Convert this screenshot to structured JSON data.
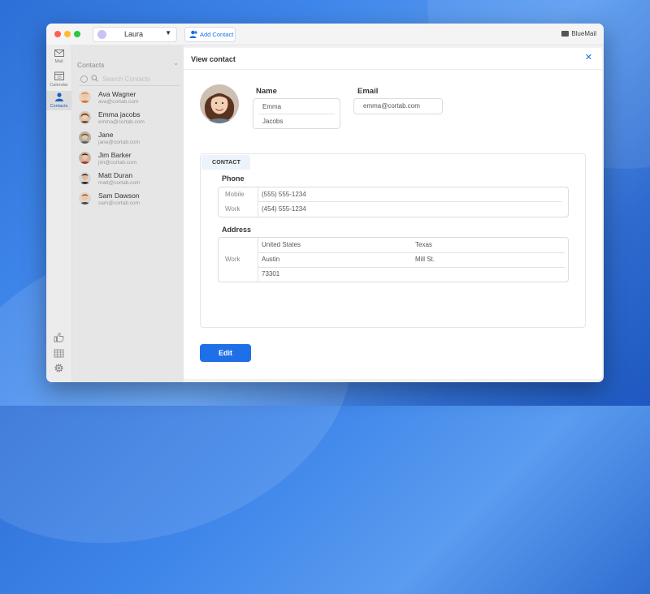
{
  "titlebar": {
    "account_name": "Laura",
    "add_contact_label": "Add Contact",
    "brand": "BlueMail"
  },
  "rail": {
    "items": [
      {
        "label": "Mail",
        "icon": "mail-icon"
      },
      {
        "label": "Calendar",
        "icon": "calendar-icon",
        "badge": "15"
      },
      {
        "label": "Contacts",
        "icon": "contacts-icon",
        "active": true
      }
    ],
    "bottom_icons": [
      "thumbs-up-icon",
      "grid-icon",
      "settings-gear-icon"
    ]
  },
  "sidebar": {
    "title": "Contacts",
    "search_placeholder": "Search Contacts",
    "contacts": [
      {
        "name": "Ava Wagner",
        "email": "ava@cortab.com",
        "avatar_color": "#c48a5e"
      },
      {
        "name": "Emma jacobs",
        "email": "emma@cortab.com",
        "avatar_color": "#8a5a3a"
      },
      {
        "name": "Jane",
        "email": "jane@cortab.com",
        "avatar_color": "#7a6a55"
      },
      {
        "name": "Jim Barker",
        "email": "jim@cortab.com",
        "avatar_color": "#9c4a3a"
      },
      {
        "name": "Matt Duran",
        "email": "matt@cortab.com",
        "avatar_color": "#4a3a32"
      },
      {
        "name": "Sam Dawson",
        "email": "sam@cortab.com",
        "avatar_color": "#b07a58"
      }
    ]
  },
  "view": {
    "title": "View contact",
    "name_label": "Name",
    "first_name": "Emma",
    "last_name": "Jacobs",
    "email_label": "Email",
    "email": "emma@cortab.com",
    "tab_label": "CONTACT",
    "phone_label": "Phone",
    "phones": [
      {
        "type": "Mobile",
        "number": "(555) 555-1234"
      },
      {
        "type": "Work",
        "number": "(454) 555-1234"
      }
    ],
    "address_label": "Address",
    "address": {
      "type": "Work",
      "country": "United States",
      "state": "Texas",
      "city": "Austin",
      "street": "Mill St.",
      "zip": "73301"
    },
    "edit_label": "Edit"
  },
  "colors": {
    "accent": "#1f6fe8",
    "desktop_blue": "#3f86ea"
  }
}
